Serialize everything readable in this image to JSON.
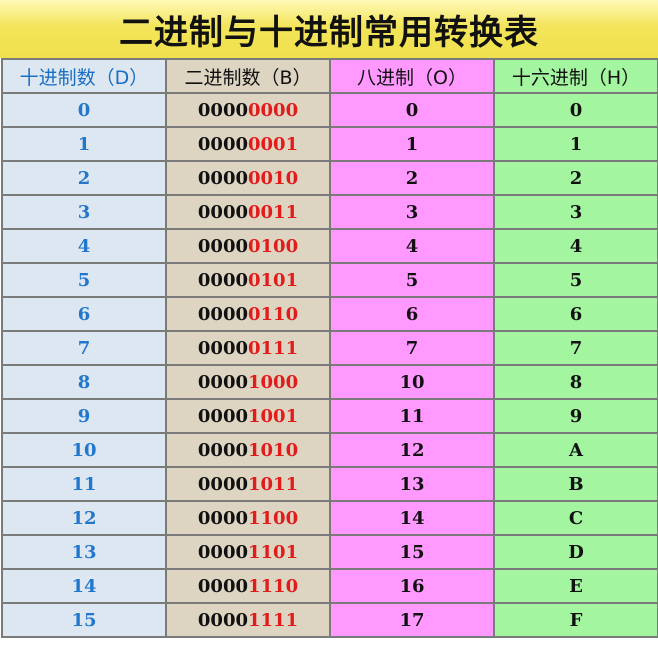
{
  "title": "二进制与十进制常用转换表",
  "headers": {
    "decimal": "十进制数（D）",
    "binary": "二进制数（B）",
    "octal": "八进制（O）",
    "hex": "十六进制（H）"
  },
  "rows": [
    {
      "dec": "0",
      "bin_hi": "0000",
      "bin_lo": "0000",
      "oct": "0",
      "hex": "0"
    },
    {
      "dec": "1",
      "bin_hi": "0000",
      "bin_lo": "0001",
      "oct": "1",
      "hex": "1"
    },
    {
      "dec": "2",
      "bin_hi": "0000",
      "bin_lo": "0010",
      "oct": "2",
      "hex": "2"
    },
    {
      "dec": "3",
      "bin_hi": "0000",
      "bin_lo": "0011",
      "oct": "3",
      "hex": "3"
    },
    {
      "dec": "4",
      "bin_hi": "0000",
      "bin_lo": "0100",
      "oct": "4",
      "hex": "4"
    },
    {
      "dec": "5",
      "bin_hi": "0000",
      "bin_lo": "0101",
      "oct": "5",
      "hex": "5"
    },
    {
      "dec": "6",
      "bin_hi": "0000",
      "bin_lo": "0110",
      "oct": "6",
      "hex": "6"
    },
    {
      "dec": "7",
      "bin_hi": "0000",
      "bin_lo": "0111",
      "oct": "7",
      "hex": "7"
    },
    {
      "dec": "8",
      "bin_hi": "0000",
      "bin_lo": "1000",
      "oct": "10",
      "hex": "8"
    },
    {
      "dec": "9",
      "bin_hi": "0000",
      "bin_lo": "1001",
      "oct": "11",
      "hex": "9"
    },
    {
      "dec": "10",
      "bin_hi": "0000",
      "bin_lo": "1010",
      "oct": "12",
      "hex": "A"
    },
    {
      "dec": "11",
      "bin_hi": "0000",
      "bin_lo": "1011",
      "oct": "13",
      "hex": "B"
    },
    {
      "dec": "12",
      "bin_hi": "0000",
      "bin_lo": "1100",
      "oct": "14",
      "hex": "C"
    },
    {
      "dec": "13",
      "bin_hi": "0000",
      "bin_lo": "1101",
      "oct": "15",
      "hex": "D"
    },
    {
      "dec": "14",
      "bin_hi": "0000",
      "bin_lo": "1110",
      "oct": "16",
      "hex": "E"
    },
    {
      "dec": "15",
      "bin_hi": "0000",
      "bin_lo": "1111",
      "oct": "17",
      "hex": "F"
    }
  ],
  "colors": {
    "title_bg": "#f0e04d",
    "decimal_bg": "#dde7f1",
    "decimal_text": "#2277cc",
    "binary_bg": "#ddd4c2",
    "binary_low_bits": "#e21b1b",
    "octal_bg": "#ff99ff",
    "hex_bg": "#a4f5a0"
  }
}
